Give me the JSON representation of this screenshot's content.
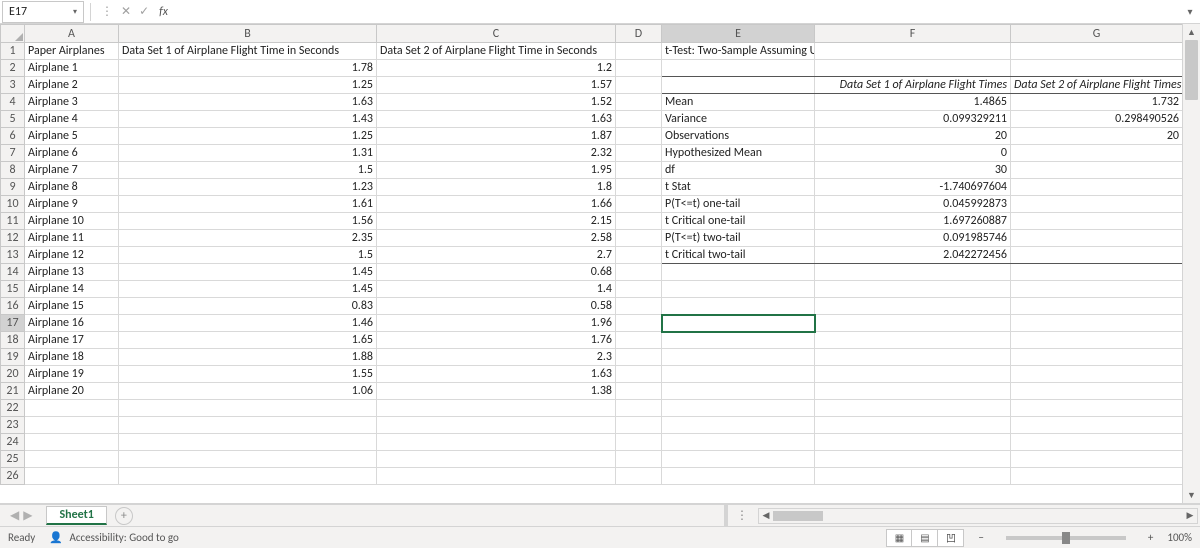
{
  "namebox": {
    "value": "E17"
  },
  "formula_bar": {
    "value": ""
  },
  "columns": [
    "A",
    "B",
    "C",
    "D",
    "E",
    "F",
    "G"
  ],
  "row_count": 26,
  "active": {
    "row": 17,
    "col": "E"
  },
  "cells": {
    "A1": {
      "v": "Paper Airplanes",
      "align": "txt"
    },
    "B1": {
      "v": "Data Set 1 of Airplane Flight Time in Seconds",
      "align": "txt"
    },
    "C1": {
      "v": "Data Set 2 of Airplane Flight Time in Seconds",
      "align": "txt"
    },
    "E1": {
      "v": "t-Test: Two-Sample Assuming Unequal Variances",
      "align": "txt"
    },
    "A2": {
      "v": "Airplane 1",
      "align": "txt"
    },
    "B2": {
      "v": "1.78",
      "align": "num"
    },
    "C2": {
      "v": "1.2",
      "align": "num"
    },
    "A3": {
      "v": "Airplane 2",
      "align": "txt"
    },
    "B3": {
      "v": "1.25",
      "align": "num"
    },
    "C3": {
      "v": "1.57",
      "align": "num"
    },
    "A4": {
      "v": "Airplane 3",
      "align": "txt"
    },
    "B4": {
      "v": "1.63",
      "align": "num"
    },
    "C4": {
      "v": "1.52",
      "align": "num"
    },
    "A5": {
      "v": "Airplane 4",
      "align": "txt"
    },
    "B5": {
      "v": "1.43",
      "align": "num"
    },
    "C5": {
      "v": "1.63",
      "align": "num"
    },
    "A6": {
      "v": "Airplane 5",
      "align": "txt"
    },
    "B6": {
      "v": "1.25",
      "align": "num"
    },
    "C6": {
      "v": "1.87",
      "align": "num"
    },
    "A7": {
      "v": "Airplane 6",
      "align": "txt"
    },
    "B7": {
      "v": "1.31",
      "align": "num"
    },
    "C7": {
      "v": "2.32",
      "align": "num"
    },
    "A8": {
      "v": "Airplane 7",
      "align": "txt"
    },
    "B8": {
      "v": "1.5",
      "align": "num"
    },
    "C8": {
      "v": "1.95",
      "align": "num"
    },
    "A9": {
      "v": "Airplane 8",
      "align": "txt"
    },
    "B9": {
      "v": "1.23",
      "align": "num"
    },
    "C9": {
      "v": "1.8",
      "align": "num"
    },
    "A10": {
      "v": "Airplane 9",
      "align": "txt"
    },
    "B10": {
      "v": "1.61",
      "align": "num"
    },
    "C10": {
      "v": "1.66",
      "align": "num"
    },
    "A11": {
      "v": "Airplane 10",
      "align": "txt"
    },
    "B11": {
      "v": "1.56",
      "align": "num"
    },
    "C11": {
      "v": "2.15",
      "align": "num"
    },
    "A12": {
      "v": "Airplane 11",
      "align": "txt"
    },
    "B12": {
      "v": "2.35",
      "align": "num"
    },
    "C12": {
      "v": "2.58",
      "align": "num"
    },
    "A13": {
      "v": "Airplane 12",
      "align": "txt"
    },
    "B13": {
      "v": "1.5",
      "align": "num"
    },
    "C13": {
      "v": "2.7",
      "align": "num"
    },
    "A14": {
      "v": "Airplane 13",
      "align": "txt"
    },
    "B14": {
      "v": "1.45",
      "align": "num"
    },
    "C14": {
      "v": "0.68",
      "align": "num"
    },
    "A15": {
      "v": "Airplane 14",
      "align": "txt"
    },
    "B15": {
      "v": "1.45",
      "align": "num"
    },
    "C15": {
      "v": "1.4",
      "align": "num"
    },
    "A16": {
      "v": "Airplane 15",
      "align": "txt"
    },
    "B16": {
      "v": "0.83",
      "align": "num"
    },
    "C16": {
      "v": "0.58",
      "align": "num"
    },
    "A17": {
      "v": "Airplane 16",
      "align": "txt"
    },
    "B17": {
      "v": "1.46",
      "align": "num"
    },
    "C17": {
      "v": "1.96",
      "align": "num"
    },
    "A18": {
      "v": "Airplane 17",
      "align": "txt"
    },
    "B18": {
      "v": "1.65",
      "align": "num"
    },
    "C18": {
      "v": "1.76",
      "align": "num"
    },
    "A19": {
      "v": "Airplane 18",
      "align": "txt"
    },
    "B19": {
      "v": "1.88",
      "align": "num"
    },
    "C19": {
      "v": "2.3",
      "align": "num"
    },
    "A20": {
      "v": "Airplane 19",
      "align": "txt"
    },
    "B20": {
      "v": "1.55",
      "align": "num"
    },
    "C20": {
      "v": "1.63",
      "align": "num"
    },
    "A21": {
      "v": "Airplane 20",
      "align": "txt"
    },
    "B21": {
      "v": "1.06",
      "align": "num"
    },
    "C21": {
      "v": "1.38",
      "align": "num"
    },
    "E2": {
      "v": "",
      "align": "txt",
      "bb": true
    },
    "F2": {
      "v": "",
      "align": "txt",
      "bb": true
    },
    "G2": {
      "v": "",
      "align": "txt",
      "bb": true
    },
    "F3": {
      "v": "Data Set 1 of Airplane Flight Times",
      "align": "italic",
      "bb": true
    },
    "G3": {
      "v": "Data Set 2 of Airplane Flight Times",
      "align": "italic",
      "bb": true
    },
    "E3": {
      "v": "",
      "align": "txt",
      "bb": true
    },
    "E4": {
      "v": "Mean",
      "align": "txt"
    },
    "F4": {
      "v": "1.4865",
      "align": "num"
    },
    "G4": {
      "v": "1.732",
      "align": "num"
    },
    "E5": {
      "v": "Variance",
      "align": "txt"
    },
    "F5": {
      "v": "0.099329211",
      "align": "num"
    },
    "G5": {
      "v": "0.298490526",
      "align": "num"
    },
    "E6": {
      "v": "Observations",
      "align": "txt"
    },
    "F6": {
      "v": "20",
      "align": "num"
    },
    "G6": {
      "v": "20",
      "align": "num"
    },
    "E7": {
      "v": "Hypothesized Mean",
      "align": "txt"
    },
    "F7": {
      "v": "0",
      "align": "num"
    },
    "E8": {
      "v": "df",
      "align": "txt"
    },
    "F8": {
      "v": "30",
      "align": "num"
    },
    "E9": {
      "v": "t Stat",
      "align": "txt"
    },
    "F9": {
      "v": "-1.740697604",
      "align": "num"
    },
    "E10": {
      "v": "P(T<=t) one-tail",
      "align": "txt"
    },
    "F10": {
      "v": "0.045992873",
      "align": "num"
    },
    "E11": {
      "v": "t Critical one-tail",
      "align": "txt"
    },
    "F11": {
      "v": "1.697260887",
      "align": "num"
    },
    "E12": {
      "v": "P(T<=t) two-tail",
      "align": "txt"
    },
    "F12": {
      "v": "0.091985746",
      "align": "num"
    },
    "E13": {
      "v": "t Critical two-tail",
      "align": "txt",
      "bb": true
    },
    "F13": {
      "v": "2.042272456",
      "align": "num",
      "bb": true
    },
    "G13": {
      "v": "",
      "align": "txt",
      "bb": true
    }
  },
  "sheet_tab": {
    "name": "Sheet1"
  },
  "status": {
    "ready": "Ready",
    "accessibility": "Accessibility: Good to go",
    "zoom": "100%"
  },
  "glyphs": {
    "minus": "−",
    "plus": "+",
    "chev_down": "▾",
    "triangle_l": "◀",
    "triangle_r": "▶",
    "x": "✕",
    "check": "✓",
    "fx": "fx",
    "ellipsis": "⋮",
    "grid": "▦",
    "page": "▤",
    "break": "凹",
    "person": "👤"
  }
}
